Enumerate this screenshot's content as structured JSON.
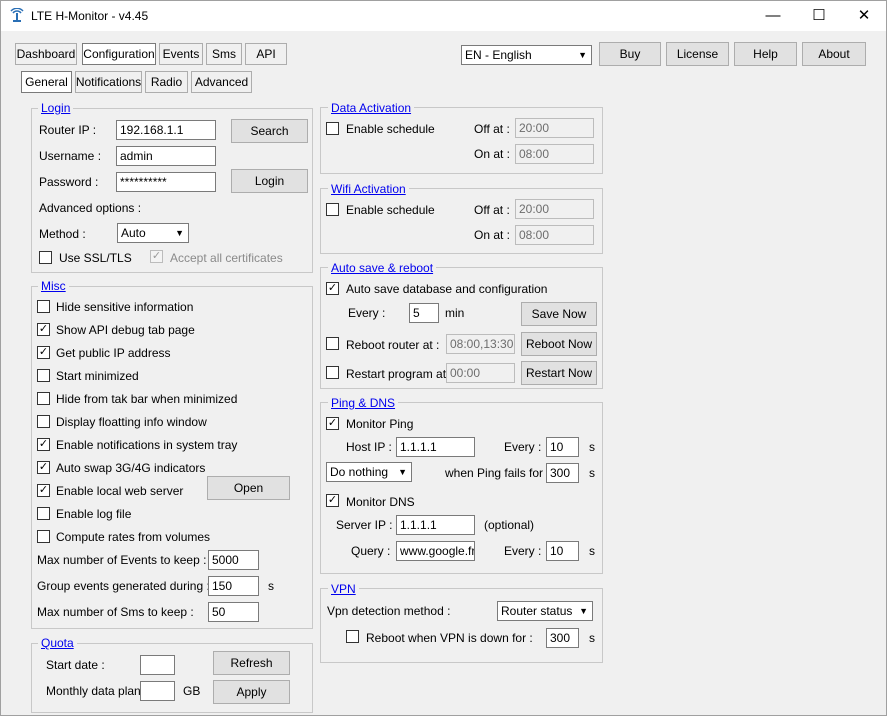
{
  "app": {
    "title": "LTE H-Monitor - v4.45"
  },
  "window_controls": {
    "minimize": "—",
    "maximize": "☐",
    "close": "✕"
  },
  "top_tabs": [
    "Dashboard",
    "Configuration",
    "Events",
    "Sms",
    "API"
  ],
  "sub_tabs": [
    "General",
    "Notifications",
    "Radio",
    "Advanced"
  ],
  "language": {
    "selected": "EN - English"
  },
  "top_buttons": {
    "buy": "Buy",
    "license": "License",
    "help": "Help",
    "about": "About"
  },
  "login": {
    "title": "Login",
    "router_ip_label": "Router IP :",
    "router_ip": "192.168.1.1",
    "search": "Search",
    "username_label": "Username :",
    "username": "admin",
    "password_label": "Password :",
    "password": "**********",
    "login_button": "Login",
    "advanced_label": "Advanced options :",
    "method_label": "Method :",
    "method": "Auto",
    "ssl_label": "Use SSL/TLS",
    "accept_label": "Accept all certificates"
  },
  "misc": {
    "title": "Misc",
    "items": [
      {
        "label": "Hide sensitive information",
        "checked": false
      },
      {
        "label": "Show API debug tab page",
        "checked": true
      },
      {
        "label": "Get public IP address",
        "checked": true
      },
      {
        "label": "Start minimized",
        "checked": false
      },
      {
        "label": "Hide from tak bar when minimized",
        "checked": false
      },
      {
        "label": "Display floatting info window",
        "checked": false
      },
      {
        "label": "Enable notifications in system tray",
        "checked": true
      },
      {
        "label": "Auto swap 3G/4G indicators",
        "checked": true
      },
      {
        "label": "Enable local web server",
        "checked": true
      },
      {
        "label": "Enable log file",
        "checked": false
      },
      {
        "label": "Compute rates from volumes",
        "checked": false
      }
    ],
    "open_button": "Open",
    "max_events_label": "Max number of Events to keep :",
    "max_events": "5000",
    "group_label": "Group events generated  during :",
    "group_value": "150",
    "group_unit": "s",
    "max_sms_label": "Max number of Sms to keep :",
    "max_sms": "50"
  },
  "quota": {
    "title": "Quota",
    "start_label": "Start date :",
    "start_value": "",
    "refresh": "Refresh",
    "plan_label": "Monthly data plan :",
    "plan_value": "",
    "plan_unit": "GB",
    "apply": "Apply"
  },
  "data_activation": {
    "title": "Data Activation",
    "enable_label": "Enable schedule",
    "off_label": "Off at :",
    "off_value": "20:00",
    "on_label": "On at :",
    "on_value": "08:00"
  },
  "wifi_activation": {
    "title": "Wifi Activation",
    "enable_label": "Enable schedule",
    "off_label": "Off at :",
    "off_value": "20:00",
    "on_label": "On at :",
    "on_value": "08:00"
  },
  "autosave": {
    "title": "Auto save & reboot",
    "autosave_label": "Auto save database and configuration",
    "every_label": "Every :",
    "every_value": "5",
    "every_unit": "min",
    "save_now": "Save Now",
    "reboot_label": "Reboot router at :",
    "reboot_value": "08:00,13:30",
    "reboot_now": "Reboot Now",
    "restart_label": "Restart program at :",
    "restart_value": "00:00",
    "restart_now": "Restart Now"
  },
  "ping": {
    "title": "Ping & DNS",
    "monitor_ping_label": "Monitor Ping",
    "host_label": "Host IP :",
    "host_value": "1.1.1.1",
    "every_label": "Every :",
    "every_value": "10",
    "unit_s": "s",
    "action": "Do nothing",
    "fails_label": "when Ping fails for :",
    "fails_value": "300",
    "monitor_dns_label": "Monitor DNS",
    "server_label": "Server IP :",
    "server_value": "1.1.1.1",
    "optional": "(optional)",
    "query_label": "Query :",
    "query_value": "www.google.fr",
    "dns_every_label": "Every :",
    "dns_every_value": "10"
  },
  "vpn": {
    "title": "VPN",
    "method_label": "Vpn detection method :",
    "method": "Router status",
    "reboot_label": "Reboot when VPN is down for :",
    "reboot_value": "300",
    "unit": "s"
  }
}
